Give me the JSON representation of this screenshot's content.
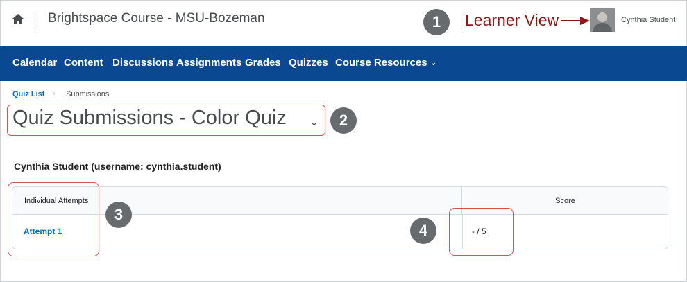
{
  "header": {
    "course_title": "Brightspace Course - MSU-Bozeman",
    "annotation_label": "Learner View",
    "user_name": "Cynthia Student"
  },
  "nav": {
    "items": [
      {
        "label": "Calendar"
      },
      {
        "label": "Content"
      },
      {
        "label": "Discussions"
      },
      {
        "label": "Assignments"
      },
      {
        "label": "Grades"
      },
      {
        "label": "Quizzes"
      },
      {
        "label": "Course Resources"
      }
    ]
  },
  "breadcrumb": {
    "link": "Quiz List",
    "current": "Submissions"
  },
  "page": {
    "title": "Quiz Submissions - Color Quiz",
    "user_heading": "Cynthia Student (username: cynthia.student)"
  },
  "table": {
    "columns": [
      "Individual Attempts",
      "Score"
    ],
    "rows": [
      {
        "attempt": "Attempt 1",
        "score": "- / 5"
      }
    ]
  },
  "callouts": [
    "1",
    "2",
    "3",
    "4"
  ],
  "icons": {
    "home": "home-icon",
    "arrow": "arrow-right-icon",
    "chevron": "chevron-down-icon"
  },
  "colors": {
    "nav_bg": "#0b4892",
    "link": "#006fbf",
    "annotation": "#8b1a1a",
    "highlight": "#d9534f",
    "callout_bg": "#676b6e"
  }
}
